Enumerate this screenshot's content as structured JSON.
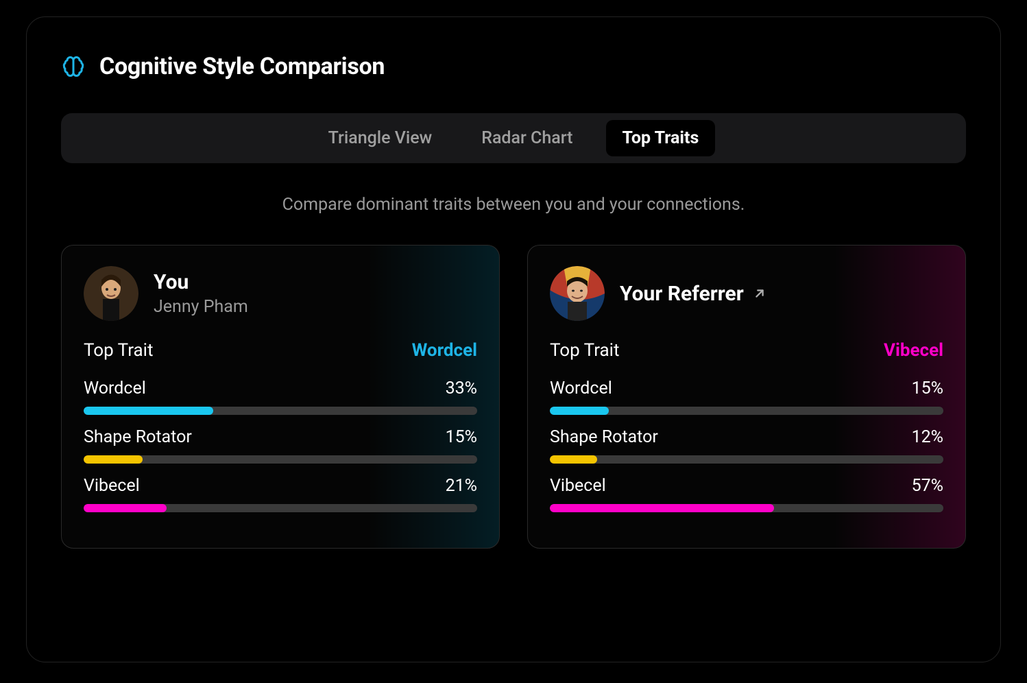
{
  "header": {
    "title": "Cognitive Style Comparison",
    "icon": "brain-icon"
  },
  "tabs": [
    {
      "id": "triangle",
      "label": "Triangle View",
      "active": false
    },
    {
      "id": "radar",
      "label": "Radar Chart",
      "active": false
    },
    {
      "id": "top-traits",
      "label": "Top Traits",
      "active": true
    }
  ],
  "subheading": "Compare dominant traits between you and your connections.",
  "traits_meta": {
    "top_trait_label": "Top Trait",
    "colors": {
      "Wordcel": "#1AC7F0",
      "Shape Rotator": "#F5C400",
      "Vibecel": "#FF00C8"
    }
  },
  "cards": {
    "you": {
      "label": "You",
      "name": "Jenny Pham",
      "tint": "cyan",
      "top_trait": {
        "name": "Wordcel",
        "color": "cyan"
      },
      "traits": [
        {
          "name": "Wordcel",
          "pct": 33,
          "color": "cyan"
        },
        {
          "name": "Shape Rotator",
          "pct": 15,
          "color": "yellow"
        },
        {
          "name": "Vibecel",
          "pct": 21,
          "color": "pink"
        }
      ]
    },
    "referrer": {
      "label": "Your Referrer",
      "link": true,
      "tint": "pink",
      "top_trait": {
        "name": "Vibecel",
        "color": "pink"
      },
      "traits": [
        {
          "name": "Wordcel",
          "pct": 15,
          "color": "cyan"
        },
        {
          "name": "Shape Rotator",
          "pct": 12,
          "color": "yellow"
        },
        {
          "name": "Vibecel",
          "pct": 57,
          "color": "pink"
        }
      ]
    }
  },
  "chart_data": [
    {
      "type": "bar",
      "title": "You — Jenny Pham",
      "categories": [
        "Wordcel",
        "Shape Rotator",
        "Vibecel"
      ],
      "values": [
        33,
        15,
        21
      ],
      "ylim": [
        0,
        100
      ],
      "ylabel": "%"
    },
    {
      "type": "bar",
      "title": "Your Referrer",
      "categories": [
        "Wordcel",
        "Shape Rotator",
        "Vibecel"
      ],
      "values": [
        15,
        12,
        57
      ],
      "ylim": [
        0,
        100
      ],
      "ylabel": "%"
    }
  ]
}
